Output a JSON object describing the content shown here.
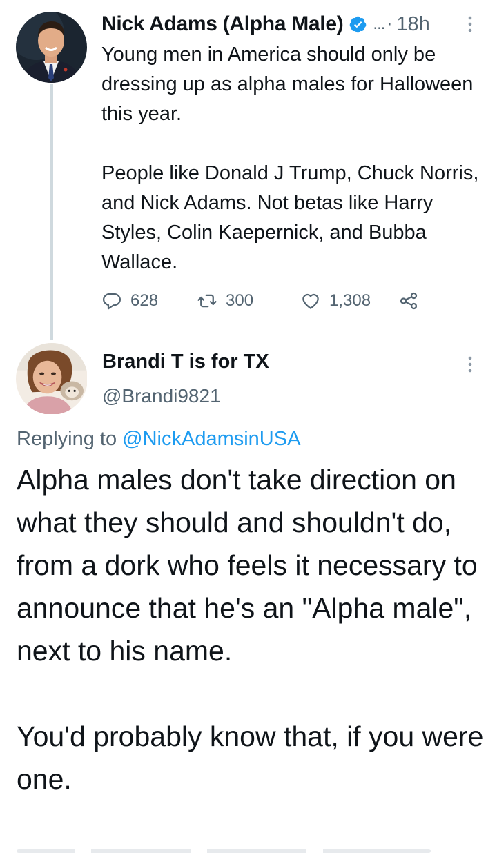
{
  "tweet": {
    "author_name": "Nick Adams (Alpha Male)",
    "handle_truncated": "...",
    "dot": "·",
    "time": "18h",
    "body": "Young men in America should only be dressing up as alpha males for Halloween this year.\n\nPeople like Donald J Trump, Chuck Norris, and Nick Adams. Not betas like Harry Styles, Colin Kaepernick, and Bubba Wallace.",
    "replies": "628",
    "retweets": "300",
    "likes": "1,308",
    "verified": true,
    "avatar_icon": "person-in-suit-avatar"
  },
  "reply": {
    "author_name": "Brandi T is for TX",
    "handle": "@Brandi9821",
    "replying_prefix": "Replying to",
    "replying_to": "@NickAdamsinUSA",
    "body": "Alpha males don't take direction on what they should and shouldn't do, from a dork who feels it necessary to announce that he's an \"Alpha male\", next to his name.\n\nYou'd probably know that, if you were one.",
    "avatar_icon": "woman-with-hedgehog-avatar"
  },
  "colors": {
    "text": "#0f1419",
    "secondary": "#536471",
    "link": "#1d9bf0",
    "verified": "#1d9bf0",
    "thread_line": "#cfd9de"
  }
}
